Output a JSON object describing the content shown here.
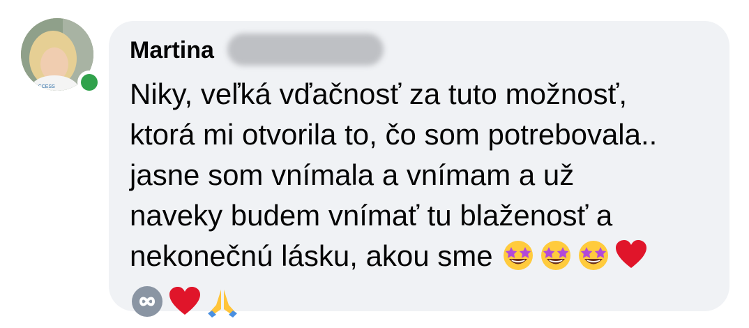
{
  "comment": {
    "author": "Martina",
    "lines": [
      "Niky, veľká vďačnosť za tuto možnosť,",
      "ktorá mi otvorila to, čo som potrebovala..",
      "jasne som vnímala a vnímam a už",
      "naveky budem vnímať tu blaženosť a",
      "nekonečnú lásku, akou sme"
    ],
    "emoji_line5": [
      "star-struck",
      "star-struck",
      "star-struck",
      "red-heart"
    ],
    "emoji_line6": [
      "infinity",
      "red-heart",
      "folded-hands"
    ]
  },
  "colors": {
    "bubble_bg": "#f0f2f5",
    "presence": "#31a24c",
    "text": "#050505"
  }
}
